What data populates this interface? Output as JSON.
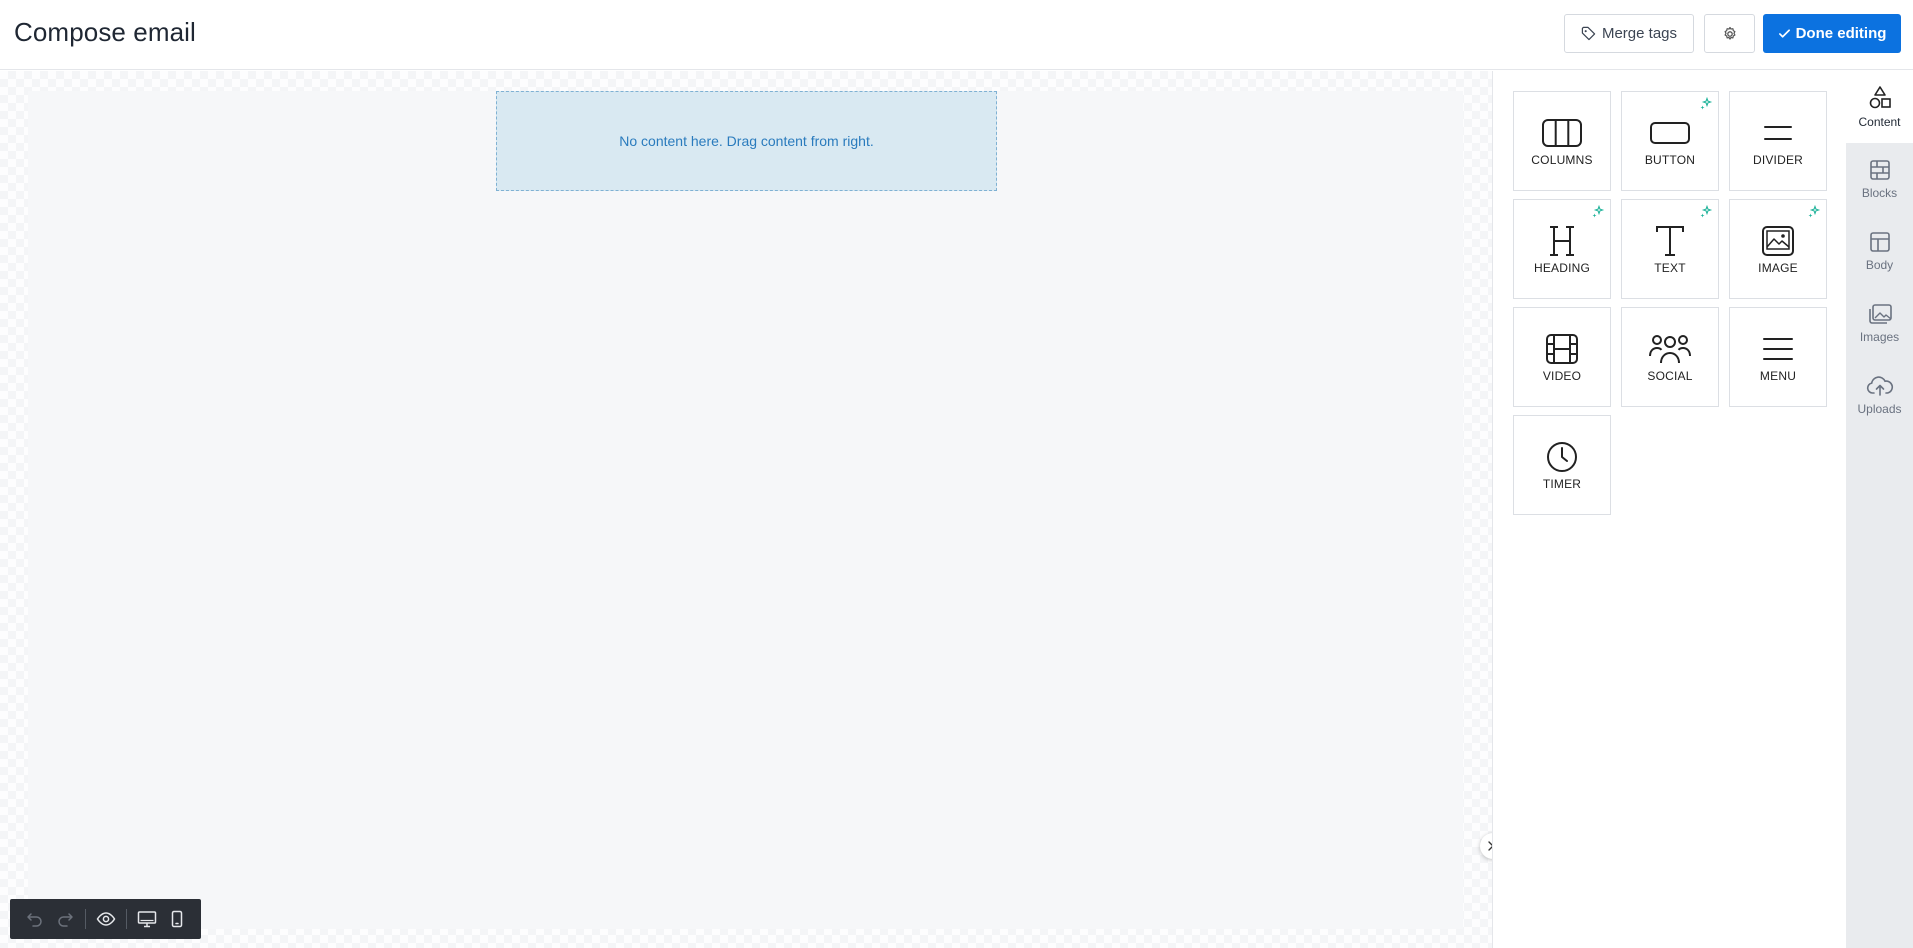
{
  "header": {
    "title": "Compose email",
    "merge_tags_label": "Merge tags",
    "done_label": "Done editing"
  },
  "canvas": {
    "empty_message": "No content here. Drag content from right."
  },
  "content_tiles": [
    {
      "label": "COLUMNS",
      "icon": "columns-icon",
      "ai": false
    },
    {
      "label": "BUTTON",
      "icon": "button-icon",
      "ai": true
    },
    {
      "label": "DIVIDER",
      "icon": "divider-icon",
      "ai": false
    },
    {
      "label": "HEADING",
      "icon": "heading-icon",
      "ai": true
    },
    {
      "label": "TEXT",
      "icon": "text-icon",
      "ai": true
    },
    {
      "label": "IMAGE",
      "icon": "image-icon",
      "ai": true
    },
    {
      "label": "VIDEO",
      "icon": "video-icon",
      "ai": false
    },
    {
      "label": "SOCIAL",
      "icon": "social-icon",
      "ai": false
    },
    {
      "label": "MENU",
      "icon": "menu-icon",
      "ai": false
    },
    {
      "label": "TIMER",
      "icon": "timer-icon",
      "ai": false
    }
  ],
  "rail_tabs": [
    {
      "label": "Content",
      "icon": "shapes-icon",
      "active": true
    },
    {
      "label": "Blocks",
      "icon": "blocks-icon",
      "active": false
    },
    {
      "label": "Body",
      "icon": "body-layout-icon",
      "active": false
    },
    {
      "label": "Images",
      "icon": "images-icon",
      "active": false
    },
    {
      "label": "Uploads",
      "icon": "upload-cloud-icon",
      "active": false
    }
  ],
  "colors": {
    "primary": "#0c72e0",
    "ai_sparkle": "#1fb39a",
    "dropzone_bg": "#d9e9f2",
    "dropzone_text": "#2a7bbd"
  }
}
